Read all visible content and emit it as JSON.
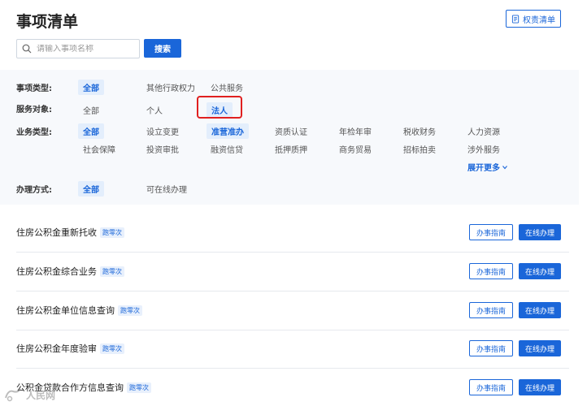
{
  "header": {
    "title": "事项清单",
    "rights_label": "权责清单"
  },
  "search": {
    "placeholder": "请输入事项名称",
    "value": "",
    "button_label": "搜索"
  },
  "filters": {
    "category": {
      "label": "事项类型:",
      "options": [
        "全部",
        "其他行政权力",
        "公共服务"
      ],
      "selected": "全部"
    },
    "target": {
      "label": "服务对象:",
      "options": [
        "全部",
        "个人",
        "法人"
      ],
      "selected": "法人"
    },
    "business": {
      "label": "业务类型:",
      "row1": [
        "全部",
        "设立变更",
        "准营准办",
        "资质认证",
        "年检年审",
        "税收财务",
        "人力资源"
      ],
      "row2": [
        "社会保障",
        "投资审批",
        "融资信贷",
        "抵押质押",
        "商务贸易",
        "招标拍卖",
        "涉外服务"
      ],
      "selected": [
        "全部",
        "准营准办"
      ],
      "more_label": "展开更多"
    },
    "method": {
      "label": "办理方式:",
      "options": [
        "全部",
        "可在线办理"
      ],
      "selected": "全部"
    }
  },
  "items": [
    {
      "title": "住房公积金重新托收",
      "tag": "跑零次"
    },
    {
      "title": "住房公积金综合业务",
      "tag": "跑零次"
    },
    {
      "title": "住房公积金单位信息查询",
      "tag": "跑零次"
    },
    {
      "title": "住房公积金年度验审",
      "tag": "跑零次"
    },
    {
      "title": "公积金贷款合作方信息查询",
      "tag": "跑零次"
    }
  ],
  "actions": {
    "guide_label": "办事指南",
    "online_label": "在线办理"
  },
  "watermark": {
    "text": "人民网"
  },
  "colors": {
    "accent": "#1a66d9",
    "highlight": "#e02020",
    "panel_bg": "#f7f9fc"
  }
}
